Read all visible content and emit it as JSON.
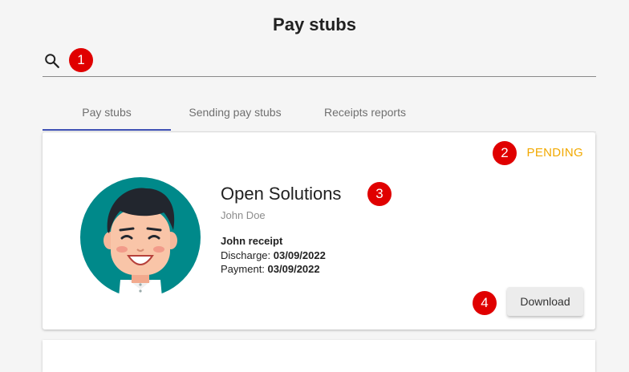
{
  "page": {
    "title": "Pay stubs"
  },
  "search": {
    "placeholder": "",
    "value": ""
  },
  "tabs": [
    {
      "label": "Pay stubs",
      "active": true
    },
    {
      "label": "Sending pay stubs",
      "active": false
    },
    {
      "label": "Receipts reports",
      "active": false
    }
  ],
  "card": {
    "status": "PENDING",
    "company": "Open Solutions",
    "person": "John Doe",
    "receipt_title": "John receipt",
    "discharge_label": "Discharge:",
    "discharge_date": "03/09/2022",
    "payment_label": "Payment:",
    "payment_date": "03/09/2022",
    "download_label": "Download"
  },
  "markers": [
    "1",
    "2",
    "3",
    "4"
  ],
  "colors": {
    "accent": "#3f51b5",
    "status_pending": "#f2a900",
    "marker": "#e00000",
    "avatar_bg": "#00898a"
  }
}
